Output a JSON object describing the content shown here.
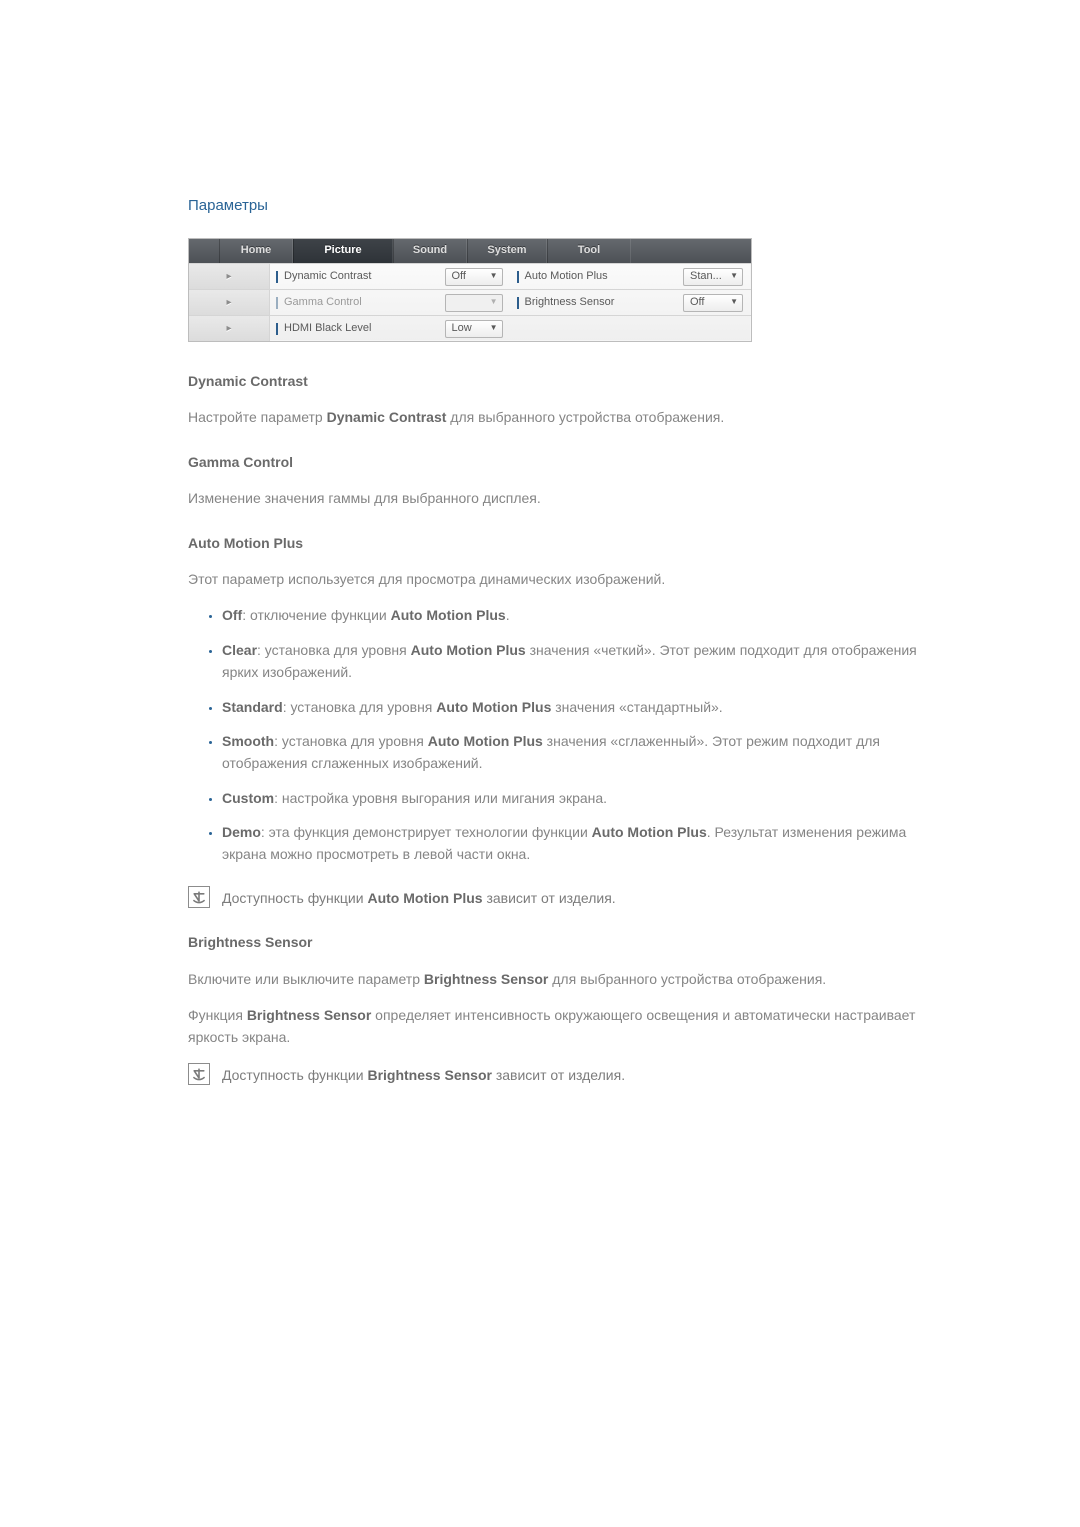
{
  "page_title": "Параметры",
  "tabs": {
    "home": "Home",
    "picture": "Picture",
    "sound": "Sound",
    "system": "System",
    "tool": "Tool"
  },
  "settings": {
    "dyn_contrast": {
      "label": "Dynamic Contrast",
      "value": "Off"
    },
    "gamma": {
      "label": "Gamma Control",
      "value": ""
    },
    "hdmi_black": {
      "label": "HDMI Black Level",
      "value": "Low"
    },
    "auto_motion": {
      "label": "Auto Motion Plus",
      "value": "Stan..."
    },
    "brightness": {
      "label": "Brightness Sensor",
      "value": "Off"
    }
  },
  "sections": {
    "dyn": {
      "h": "Dynamic Contrast",
      "p_pre": "Настройте параметр ",
      "p_b": "Dynamic Contrast",
      "p_post": " для выбранного устройства отображения."
    },
    "gamma": {
      "h": "Gamma Control",
      "p": "Изменение значения гаммы для выбранного дисплея."
    },
    "amp": {
      "h": "Auto Motion Plus",
      "p": "Этот параметр используется для просмотра динамических изображений.",
      "items": {
        "off": {
          "b": "Off",
          "rest": ": отключение функции ",
          "b2": "Auto Motion Plus",
          "rest2": "."
        },
        "clear": {
          "b": "Clear",
          "rest": ": установка для уровня ",
          "b2": "Auto Motion Plus",
          "rest2": " значения «четкий». Этот режим подходит для отображения ярких изображений."
        },
        "std": {
          "b": "Standard",
          "rest": ": установка для уровня ",
          "b2": "Auto Motion Plus",
          "rest2": " значения «стандартный»."
        },
        "smooth": {
          "b": "Smooth",
          "rest": ": установка для уровня ",
          "b2": "Auto Motion Plus",
          "rest2": " значения «сглаженный». Этот режим подходит для отображения сглаженных изображений."
        },
        "custom": {
          "b": "Custom",
          "rest": ": настройка уровня выгорания или мигания экрана."
        },
        "demo": {
          "b": "Demo",
          "rest": ": эта функция демонстрирует технологии функции ",
          "b2": "Auto Motion Plus",
          "rest2": ". Результат изменения режима экрана можно просмотреть в левой части окна."
        }
      },
      "note_pre": "Доступность функции ",
      "note_b": "Auto Motion Plus",
      "note_post": " зависит от изделия."
    },
    "bs": {
      "h": "Brightness Sensor",
      "p1_pre": "Включите или выключите параметр ",
      "p1_b": "Brightness Sensor",
      "p1_post": " для выбранного устройства отображения.",
      "p2_pre": "Функция ",
      "p2_b": "Brightness Sensor",
      "p2_post": " определяет интенсивность окружающего освещения и автоматически настраивает яркость экрана.",
      "note_pre": "Доступность функции ",
      "note_b": "Brightness Sensor",
      "note_post": " зависит от изделия."
    }
  }
}
